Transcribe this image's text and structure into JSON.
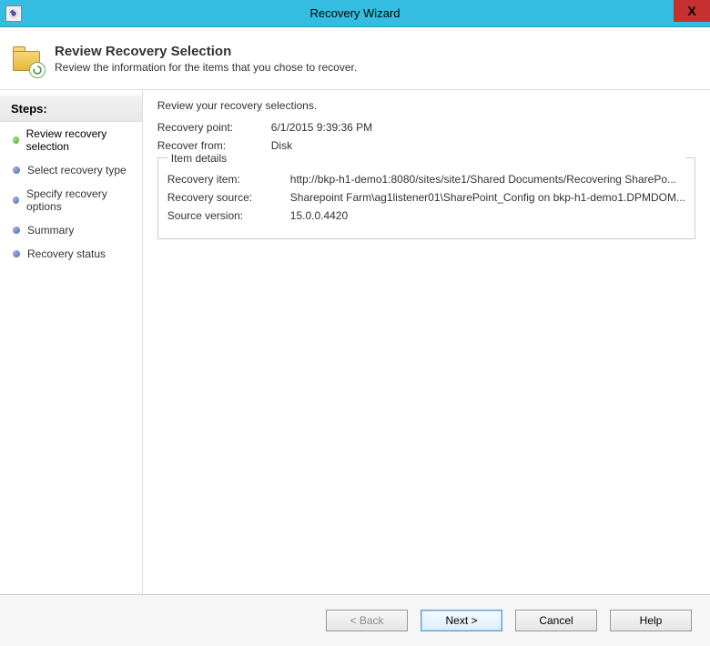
{
  "window": {
    "title": "Recovery Wizard"
  },
  "header": {
    "title": "Review Recovery Selection",
    "subtitle": "Review the information for the items that you chose to recover."
  },
  "steps": {
    "heading": "Steps:",
    "items": [
      {
        "label": "Review recovery selection",
        "current": true
      },
      {
        "label": "Select recovery type",
        "current": false
      },
      {
        "label": "Specify recovery options",
        "current": false
      },
      {
        "label": "Summary",
        "current": false
      },
      {
        "label": "Recovery status",
        "current": false
      }
    ]
  },
  "content": {
    "intro": "Review your recovery selections.",
    "recovery_point_label": "Recovery point:",
    "recovery_point_value": "6/1/2015 9:39:36 PM",
    "recover_from_label": "Recover from:",
    "recover_from_value": "Disk",
    "item_details_title": "Item details",
    "recovery_item_label": "Recovery item:",
    "recovery_item_value": "http://bkp-h1-demo1:8080/sites/site1/Shared Documents/Recovering SharePo...",
    "recovery_source_label": "Recovery source:",
    "recovery_source_value": "Sharepoint Farm\\ag1listener01\\SharePoint_Config on bkp-h1-demo1.DPMDOM...",
    "source_version_label": "Source version:",
    "source_version_value": "15.0.0.4420"
  },
  "footer": {
    "back": "< Back",
    "next": "Next >",
    "cancel": "Cancel",
    "help": "Help"
  }
}
